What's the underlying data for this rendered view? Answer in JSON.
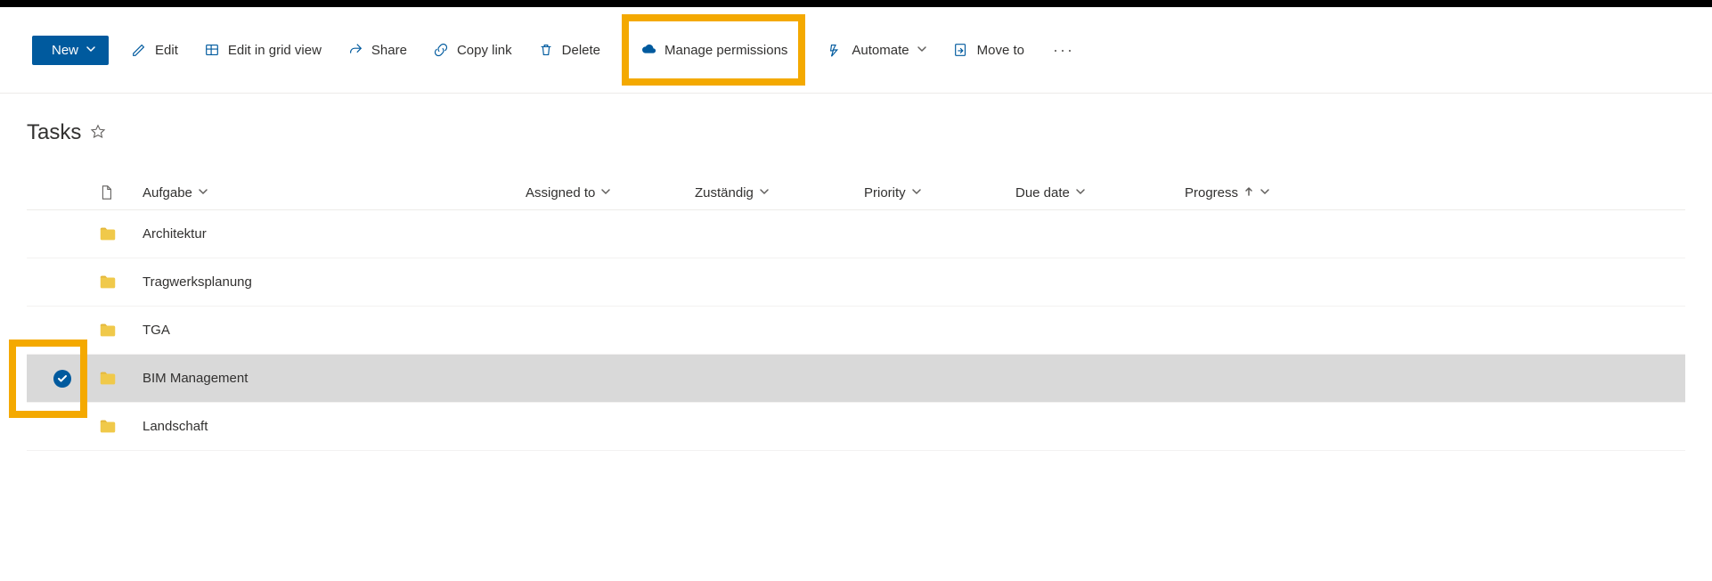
{
  "toolbar": {
    "new_label": "New",
    "edit_label": "Edit",
    "edit_grid_label": "Edit in grid view",
    "share_label": "Share",
    "copy_link_label": "Copy link",
    "delete_label": "Delete",
    "manage_permissions_label": "Manage permissions",
    "automate_label": "Automate",
    "move_to_label": "Move to"
  },
  "list": {
    "title": "Tasks"
  },
  "columns": {
    "aufgabe": "Aufgabe",
    "assigned_to": "Assigned to",
    "zustandig": "Zuständig",
    "priority": "Priority",
    "due_date": "Due date",
    "progress": "Progress"
  },
  "rows": [
    {
      "name": "Architektur",
      "selected": false
    },
    {
      "name": "Tragwerksplanung",
      "selected": false
    },
    {
      "name": "TGA",
      "selected": false
    },
    {
      "name": "BIM Management",
      "selected": true
    },
    {
      "name": "Landschaft",
      "selected": false
    }
  ]
}
